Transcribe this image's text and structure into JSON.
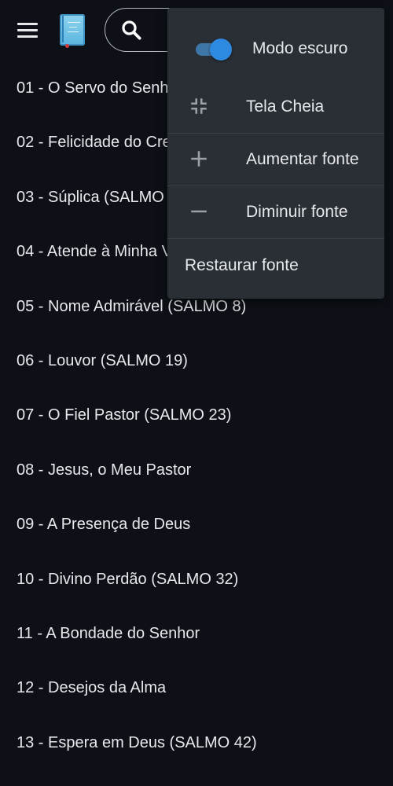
{
  "topbar": {
    "search_placeholder": ""
  },
  "list": {
    "items": [
      "01 - O Servo do Senh",
      "02 - Felicidade do Cre",
      "03 - Súplica (SALMO",
      "04 - Atende à Minha V",
      "05 - Nome Admirável (SALMO 8)",
      "06 - Louvor (SALMO 19)",
      "07 - O Fiel Pastor (SALMO 23)",
      "08 - Jesus, o Meu Pastor",
      "09 - A Presença de Deus",
      "10 - Divino Perdão (SALMO 32)",
      "11 - A Bondade do Senhor",
      "12 - Desejos da Alma",
      "13 - Espera em Deus (SALMO 42)"
    ]
  },
  "menu": {
    "dark_mode_label": "Modo escuro",
    "dark_mode_on": true,
    "fullscreen_label": "Tela Cheia",
    "increase_font_label": "Aumentar fonte",
    "decrease_font_label": "Diminuir fonte",
    "reset_font_label": "Restaurar fonte"
  },
  "colors": {
    "background": "#0d1117",
    "menu_background": "#2a2f35",
    "toggle_accent": "#2d8ae0"
  },
  "icons": {
    "menu": "hamburger-icon",
    "app": "book-icon",
    "search": "search-icon",
    "fullscreen_exit": "fullscreen-exit-icon",
    "plus": "plus-icon",
    "minus": "minus-icon"
  }
}
